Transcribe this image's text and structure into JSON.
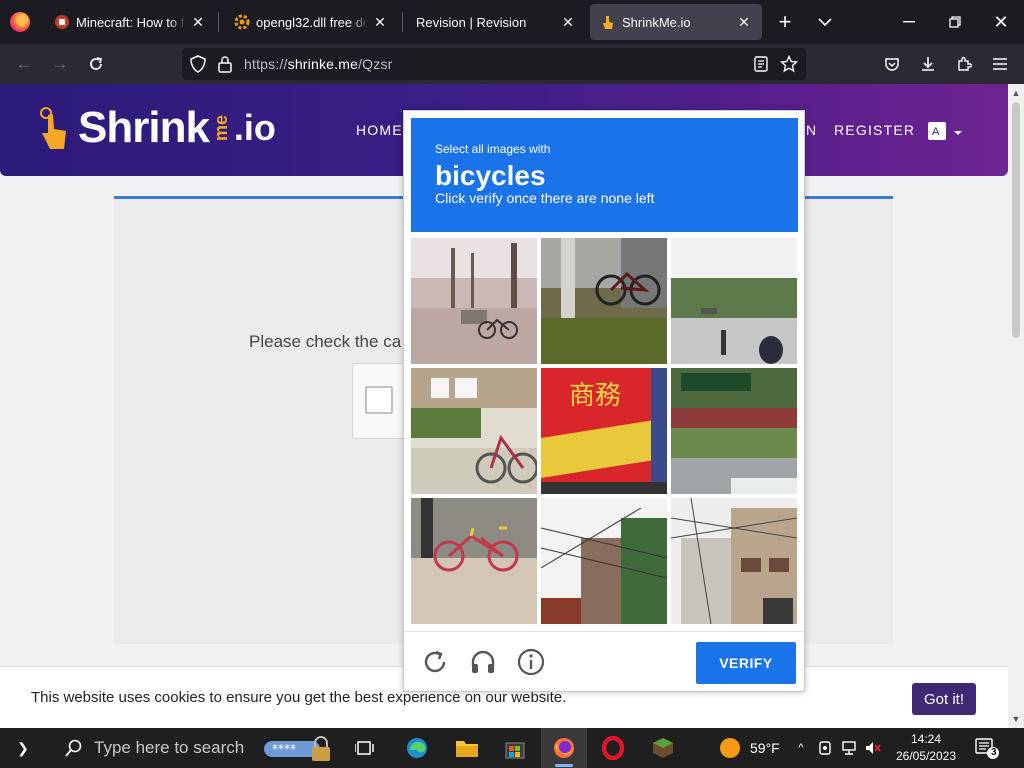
{
  "browser": {
    "tabs": [
      {
        "title": "Minecraft: How to fix",
        "favicon": "minecraft-red-favicon"
      },
      {
        "title": "opengl32.dll free dow",
        "favicon": "orange-gear-favicon"
      },
      {
        "title": "Revision | Revision",
        "favicon": ""
      },
      {
        "title": "ShrinkMe.io",
        "favicon": "shrinkme-hand-favicon",
        "active": true
      }
    ],
    "url_prefix": "https://",
    "url_host": "shrinke.me",
    "url_path": "/Qzsr"
  },
  "site": {
    "logo_main": "Shrink",
    "logo_me": "me",
    "logo_tld": ".io",
    "nav": {
      "home": "HOME",
      "login_partial": "N",
      "register": "REGISTER"
    },
    "lang_icon": "translate-icon"
  },
  "content": {
    "prompt_partial": "Please check the ca"
  },
  "captcha": {
    "instruction_small": "Select all images with",
    "target": "bicycles",
    "instruction_sub": "Click verify once there are none left",
    "verify_label": "VERIFY",
    "tiles": [
      "park-bench-bicycle",
      "bicycle-by-pole",
      "sidewalk-people",
      "parked-bicycles-building",
      "red-bus-chinese-sign",
      "green-roof-fence",
      "red-bicycle-alley",
      "power-lines-building",
      "residential-street-wires"
    ]
  },
  "cookie": {
    "text": "This website uses cookies to ensure you get the best experience on our website.",
    "button": "Got it!"
  },
  "taskbar": {
    "search_placeholder": "Type here to search",
    "temperature": "59°F",
    "time": "14:24",
    "date": "26/05/2023",
    "notifications": "3"
  }
}
